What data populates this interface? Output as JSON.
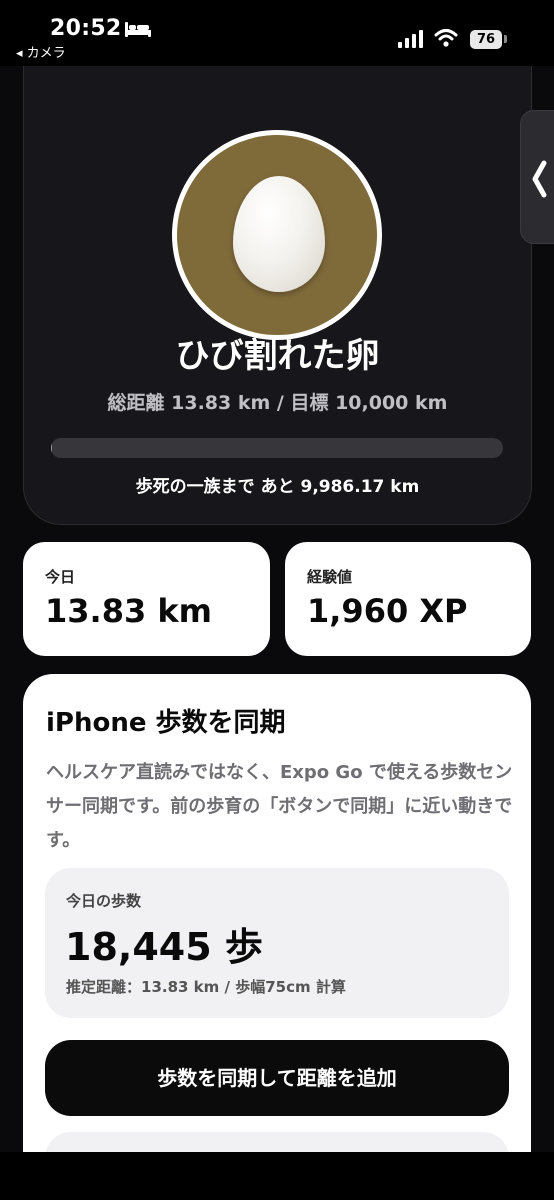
{
  "status_bar": {
    "time": "20:52",
    "back_app": "◂ カメラ",
    "battery": "76"
  },
  "egg": {
    "name": "ひび割れた卵",
    "distance_line": "総距離 13.83 km / 目標 10,000 km",
    "progress_fraction": 0.0014,
    "remaining_line": "歩死の一族まで あと 9,986.17 km"
  },
  "stats": {
    "today_label": "今日",
    "today_value": "13.83 km",
    "xp_label": "経験値",
    "xp_value": "1,960 XP"
  },
  "sync": {
    "title": "iPhone 歩数を同期",
    "description": "ヘルスケア直読みではなく、Expo Go で使える歩数センサー同期です。前の歩育の「ボタンで同期」に近い動きです。",
    "steps_label": "今日の歩数",
    "steps_value": "18,445 歩",
    "steps_note": "推定距離：13.83 km / 歩幅75cm 計算",
    "button_label": "歩数を同期して距離を追加"
  },
  "colors": {
    "egg_background": "#7f6a3a",
    "page_background": "#0a0a0c",
    "card_dark": "#17171b"
  }
}
